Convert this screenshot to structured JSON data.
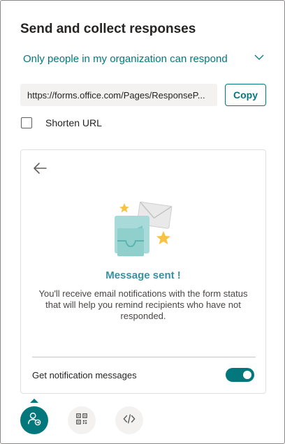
{
  "panel": {
    "title": "Send and collect responses"
  },
  "audience": {
    "selected": "Only people in my organization can respond",
    "icon": "chevron-down-icon"
  },
  "link": {
    "url": "https://forms.office.com/Pages/ResponseP...",
    "copy_label": "Copy"
  },
  "shorten": {
    "label": "Shorten URL",
    "checked": false
  },
  "card": {
    "back_icon": "arrow-left-icon",
    "message_title": "Message sent !",
    "message_body": "You'll receive email notifications with the form status that will help you remind recipients who have not responded.",
    "notification_label": "Get notification messages",
    "notification_enabled": true
  },
  "bottom_tabs": [
    {
      "icon": "share-person-icon",
      "active": true
    },
    {
      "icon": "qr-code-icon",
      "active": false
    },
    {
      "icon": "embed-code-icon",
      "active": false
    }
  ],
  "colors": {
    "accent": "#03787c",
    "message_title": "#3a8fa1"
  }
}
